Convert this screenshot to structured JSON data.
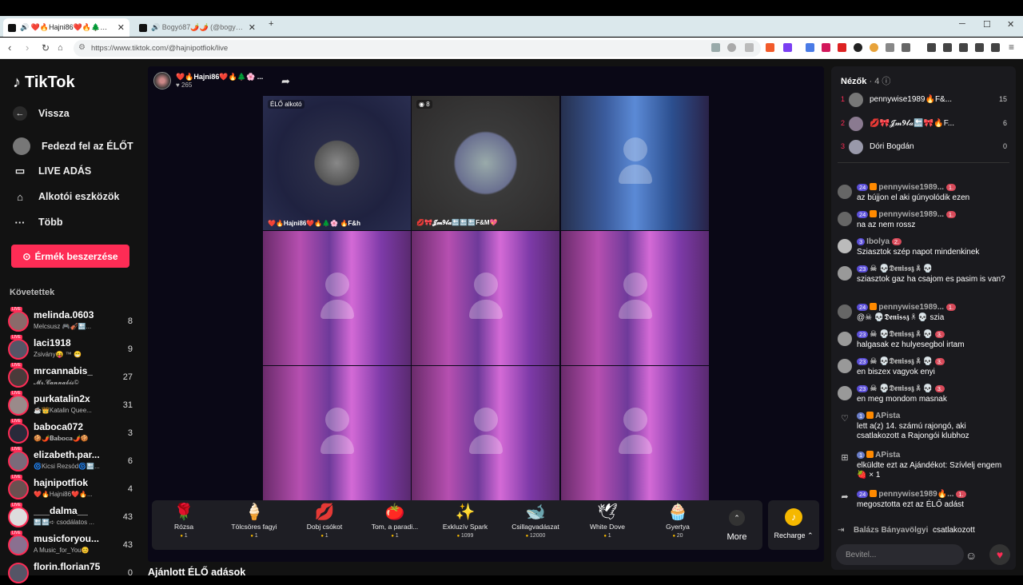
{
  "browser": {
    "tabs": [
      {
        "title": "🔊 ❤️🔥Hajni86❤️🔥🌲🌸🔥F&..."
      },
      {
        "title": "🔊 Bogyó87🌶️🌶️ (@bogyo87_) ÉL..."
      }
    ],
    "new_tab": "+",
    "url": "https://www.tiktok.com/@hajnipotfiok/live",
    "window_controls": [
      "─",
      "☐",
      "✕"
    ]
  },
  "sidebar": {
    "logo": "TikTok",
    "nav": [
      {
        "label": "Vissza",
        "icon": "back-arrow-icon"
      },
      {
        "label": "Fedezd fel az ÉLŐT",
        "icon": "avatar-icon"
      },
      {
        "label": "LIVE ADÁS",
        "icon": "video-icon"
      },
      {
        "label": "Alkotói eszközök",
        "icon": "lightbulb-icon"
      },
      {
        "label": "Több",
        "icon": "more-icon"
      }
    ],
    "coin_button": "Érmék beszerzése",
    "following_header": "Követettek",
    "following": [
      {
        "name": "melinda.0603",
        "sub": "Melcsusz 🎮🎻🔙...",
        "count": "8"
      },
      {
        "name": "laci1918",
        "sub": "Zsivány😝 ™ 😁",
        "count": "9"
      },
      {
        "name": "mrcannabis_",
        "sub": "𝓜𝓻.𝓒𝓪𝓷𝓷𝓪𝓫𝓲𝓼©",
        "count": "27"
      },
      {
        "name": "purkatalin2x",
        "sub": "☕👑Katalin Quee...",
        "count": "31"
      },
      {
        "name": "baboca072",
        "sub": "🍪🌶️𝐁𝐚𝐛𝐨𝐜𝐚🌶️🍪",
        "count": "3"
      },
      {
        "name": "elizabeth.par...",
        "sub": "🌀Kicsi Rezsód🌀🔙...",
        "count": "6"
      },
      {
        "name": "hajnipotfiok",
        "sub": "❤️🔥Hajni86❤️🔥...",
        "count": "4"
      },
      {
        "name": "___dalma__",
        "sub": "🔙🔙➪ csodálatos ...",
        "count": "43"
      },
      {
        "name": "musicforyou...",
        "sub": "A Music_for_You😊",
        "count": "43"
      },
      {
        "name": "florin.florian75",
        "sub": "",
        "count": "0"
      }
    ]
  },
  "stream": {
    "host_name": "❤️🔥Hajni86❤️🔥🌲🌸 ...",
    "host_viewers": "265",
    "cells": [
      {
        "label": "ÉLŐ alkotó",
        "caption": "❤️🔥Hajni86❤️🔥🌲🌸 🔥F&h"
      },
      {
        "label": "◉ 8",
        "caption": "💋🎀𝓙𝓶𝟗𝓵𝓪🔙🔙🔙F&M💖"
      }
    ]
  },
  "gifts": [
    {
      "name": "Rózsa",
      "price": "1",
      "icon": "🌹"
    },
    {
      "name": "Tölcsöres fagyi",
      "price": "1",
      "icon": "🍦"
    },
    {
      "name": "Dobj csókot",
      "price": "1",
      "icon": "💋"
    },
    {
      "name": "Tom, a paradi...",
      "price": "1",
      "icon": "🍅"
    },
    {
      "name": "Exkluzív Spark",
      "price": "1099",
      "icon": "✨"
    },
    {
      "name": "Csillagvadászat",
      "price": "12000",
      "icon": "🐋"
    },
    {
      "name": "White Dove",
      "price": "1",
      "icon": "🕊"
    },
    {
      "name": "Gyertya",
      "price": "20",
      "icon": "🧁"
    }
  ],
  "more_label": "More",
  "recharge_label": "Recharge ⌃",
  "recommend_title": "Ajánlott ÉLŐ adások",
  "viewers": {
    "title": "Nézők",
    "count": "· 4",
    "list": [
      {
        "rank": "1",
        "name": "pennywise1989🔥F&...",
        "score": "15"
      },
      {
        "rank": "2",
        "name": "💋🎀𝓙𝓶𝟗𝓵𝓪🔙🎀🔥F...",
        "score": "6"
      },
      {
        "rank": "3",
        "name": "Dóri Bogdán",
        "score": "0"
      }
    ]
  },
  "chat": [
    {
      "badge": "24",
      "user": "pennywise1989...",
      "lvl": "1.",
      "text": "az bújjon el aki gúnyolódik ezen"
    },
    {
      "badge": "24",
      "user": "pennywise1989...",
      "lvl": "1.",
      "text": "na az nem rossz"
    },
    {
      "badge": "3",
      "user": "Ibolya",
      "lvl": "2.",
      "text": "Sziasztok szép napot mindenkinek"
    },
    {
      "badge": "23",
      "user": "☠ 💀𝕯𝖊𝖓𝖎𝖘𝖘𝖟 ☠ 💀",
      "lvl": "",
      "text": "sziasztok gaz ha csajom es pasim is van?"
    },
    {
      "badge": "24",
      "user": "pennywise1989...",
      "lvl": "1.",
      "text": "@☠ 💀𝕯𝖊𝖓𝖎𝖘𝖘𝖟 ☠ 💀 szia"
    },
    {
      "badge": "23",
      "user": "☠ 💀𝕯𝖊𝖓𝖎𝖘𝖘𝖟 ☠ 💀",
      "lvl": "3.",
      "text": "halgasak ez hulyesegbol irtam"
    },
    {
      "badge": "23",
      "user": "☠ 💀𝕯𝖊𝖓𝖎𝖘𝖘𝖟 ☠ 💀",
      "lvl": "3.",
      "text": "en biszex vagyok enyi"
    },
    {
      "badge": "23",
      "user": "☠ 💀𝕯𝖊𝖓𝖎𝖘𝖘𝖟 ☠ 💀",
      "lvl": "3.",
      "text": "en meg mondom masnak"
    },
    {
      "badge": "1",
      "user": "APista",
      "lvl": "",
      "text": "lett a(z) 14. számú rajongó, aki csatlakozott a Rajongói klubhoz"
    },
    {
      "badge": "1",
      "user": "APista",
      "lvl": "",
      "text": "elküldte ezt az Ajándékot: Szívlelj engem 🍓 × 1"
    },
    {
      "badge": "24",
      "user": "pennywise1989🔥...",
      "lvl": "1.",
      "text": "megosztotta ezt az ÉLŐ adást"
    }
  ],
  "joined": {
    "user": "Balázs Bányavölgyi",
    "text": "csatlakozott"
  },
  "input": {
    "placeholder": "Bevitel..."
  }
}
